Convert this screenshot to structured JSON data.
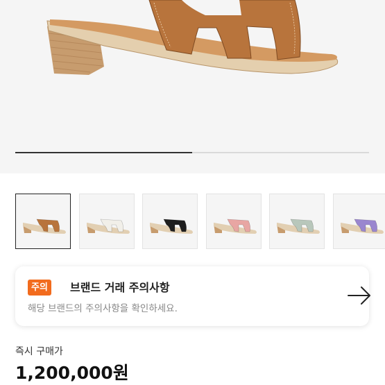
{
  "gallery": {
    "progress_fraction": 0.5,
    "thumbnails": [
      {
        "color_name": "gold",
        "color": "#b8743c",
        "selected": true
      },
      {
        "color_name": "white",
        "color": "#f1efe9",
        "selected": false
      },
      {
        "color_name": "black",
        "color": "#1e1e1e",
        "selected": false
      },
      {
        "color_name": "rose",
        "color": "#e8a6a3",
        "selected": false
      },
      {
        "color_name": "sage",
        "color": "#b8c7bb",
        "selected": false
      },
      {
        "color_name": "lavender",
        "color": "#9a86cf",
        "selected": false
      }
    ]
  },
  "notice": {
    "badge": "주의",
    "title": "브랜드 거래 주의사항",
    "description": "해당 브랜드의 주의사항을 확인하세요.",
    "arrow_icon": "arrow-right-icon"
  },
  "price": {
    "label": "즉시 구매가",
    "value": "1,200,000원"
  },
  "colors": {
    "accent": "#f26b1d",
    "heel_wood": "#c79c6e"
  }
}
